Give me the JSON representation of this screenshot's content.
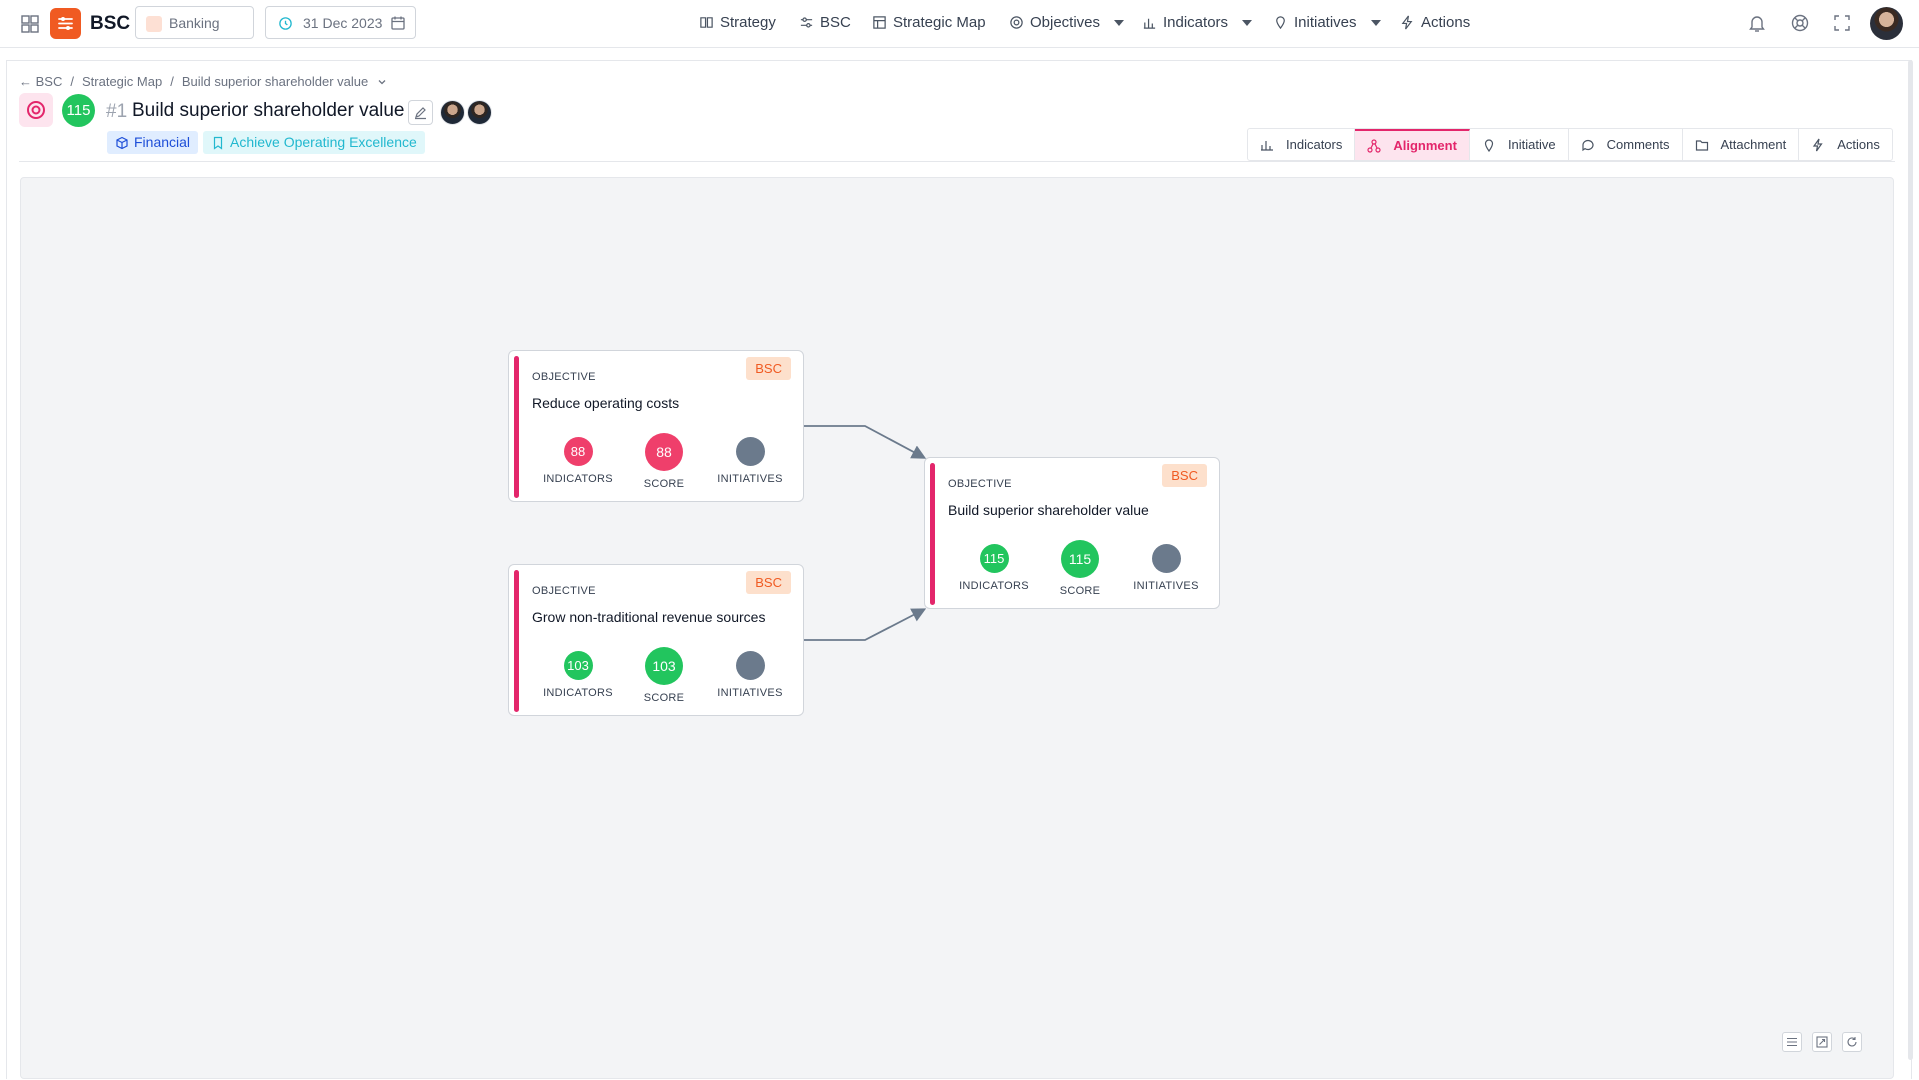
{
  "app": {
    "name": "BSC",
    "organization": "Banking",
    "date": "31 Dec 2023"
  },
  "nav": {
    "strategy": "Strategy",
    "bsc": "BSC",
    "strategic_map": "Strategic Map",
    "objectives": "Objectives",
    "indicators": "Indicators",
    "initiatives": "Initiatives",
    "actions": "Actions"
  },
  "breadcrumb": {
    "root": "BSC",
    "level2": "Strategic Map",
    "current": "Build superior shareholder value"
  },
  "objective": {
    "score": "115",
    "number": "#1",
    "title": "Build superior shareholder value",
    "perspective": "Financial",
    "theme": "Achieve Operating Excellence"
  },
  "tabs": [
    "Indicators",
    "Alignment",
    "Initiative",
    "Comments",
    "Attachment",
    "Actions"
  ],
  "active_tab": "Alignment",
  "colors": {
    "accent": "#e3266b",
    "brand": "#f05a22",
    "success": "#22c55e",
    "danger": "#ef3f6b",
    "neutral": "#6b7a8c"
  },
  "cards": {
    "reduce": {
      "kind": "OBJECTIVE",
      "badge": "BSC",
      "title": "Reduce operating costs",
      "indicators": "88",
      "score": "88",
      "initiatives": "",
      "labels": {
        "indicators": "INDICATORS",
        "score": "SCORE",
        "initiatives": "INITIATIVES"
      }
    },
    "grow": {
      "kind": "OBJECTIVE",
      "badge": "BSC",
      "title": "Grow non-traditional revenue sources",
      "indicators": "103",
      "score": "103",
      "initiatives": "",
      "labels": {
        "indicators": "INDICATORS",
        "score": "SCORE",
        "initiatives": "INITIATIVES"
      }
    },
    "build": {
      "kind": "OBJECTIVE",
      "badge": "BSC",
      "title": "Build superior shareholder value",
      "indicators": "115",
      "score": "115",
      "initiatives": "",
      "labels": {
        "indicators": "INDICATORS",
        "score": "SCORE",
        "initiatives": "INITIATIVES"
      }
    }
  },
  "icons": [
    "grid-icon",
    "bsc-logo-icon",
    "clock-icon",
    "calendar-icon",
    "bell-icon",
    "help-icon",
    "fullscreen-icon",
    "target-icon",
    "edit-icon",
    "cube-icon",
    "bookmark-icon"
  ]
}
